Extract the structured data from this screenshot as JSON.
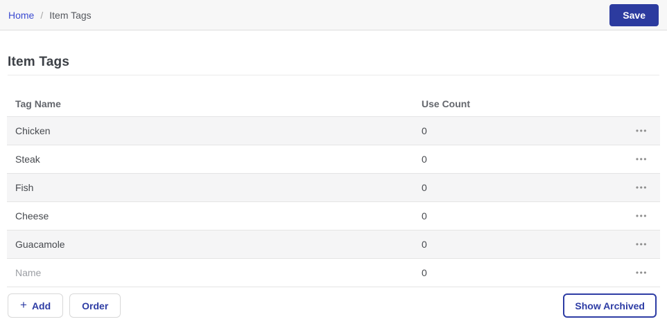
{
  "breadcrumb": {
    "home": "Home",
    "separator": "/",
    "current": "Item Tags"
  },
  "toolbar": {
    "save_label": "Save"
  },
  "page": {
    "title": "Item Tags"
  },
  "table": {
    "columns": [
      "Tag Name",
      "Use Count"
    ],
    "rows": [
      {
        "name": "Chicken",
        "use_count": "0"
      },
      {
        "name": "Steak",
        "use_count": "0"
      },
      {
        "name": "Fish",
        "use_count": "0"
      },
      {
        "name": "Cheese",
        "use_count": "0"
      },
      {
        "name": "Guacamole",
        "use_count": "0"
      }
    ],
    "new_row": {
      "placeholder": "Name",
      "value": "",
      "use_count": "0"
    },
    "row_menu_icon": "•••"
  },
  "footer": {
    "add_icon": "+",
    "add_label": "Add",
    "order_label": "Order",
    "show_archived_label": "Show Archived"
  },
  "colors": {
    "accent_blue": "#2d3ca4",
    "save_button_bg": "#2c3b9f",
    "link_blue": "#3b4bd1",
    "topbar_bg": "#f7f7f7",
    "row_stripe": "#f5f5f6",
    "border_light": "#e4e4e4"
  }
}
